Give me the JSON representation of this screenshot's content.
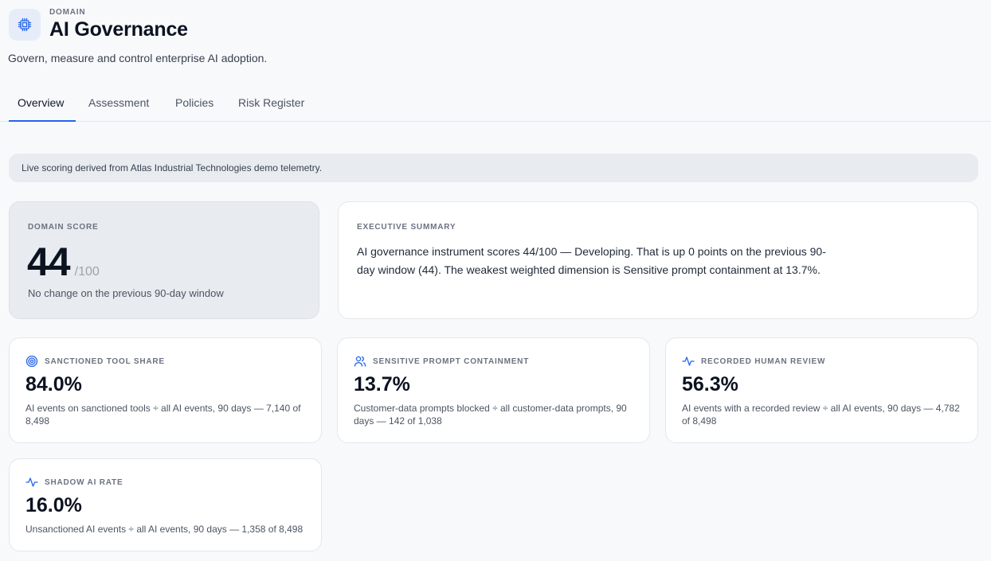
{
  "header": {
    "eyebrow": "DOMAIN",
    "title": "AI Governance",
    "subtitle": "Govern, measure and control enterprise AI adoption.",
    "icon": "cpu-chip-icon"
  },
  "tabs": [
    {
      "label": "Overview",
      "active": true
    },
    {
      "label": "Assessment",
      "active": false
    },
    {
      "label": "Policies",
      "active": false
    },
    {
      "label": "Risk Register",
      "active": false
    }
  ],
  "notice": "Live scoring derived from Atlas Industrial Technologies demo telemetry.",
  "score": {
    "eyebrow": "DOMAIN SCORE",
    "value": "44",
    "denominator": "/100",
    "note": "No change on the previous 90-day window"
  },
  "summary": {
    "eyebrow": "EXECUTIVE SUMMARY",
    "text": "AI governance instrument scores 44/100 — Developing. That is up 0 points on the previous 90-day window (44). The weakest weighted dimension is Sensitive prompt containment at 13.7%."
  },
  "metrics": [
    {
      "eyebrow": "SANCTIONED TOOL SHARE",
      "value": "84.0%",
      "desc": "AI events on sanctioned tools ÷ all AI events, 90 days — 7,140 of 8,498",
      "icon": "target-icon"
    },
    {
      "eyebrow": "SENSITIVE PROMPT CONTAINMENT",
      "value": "13.7%",
      "desc": "Customer-data prompts blocked ÷ all customer-data prompts, 90 days — 142 of 1,038",
      "icon": "users-icon"
    },
    {
      "eyebrow": "RECORDED HUMAN REVIEW",
      "value": "56.3%",
      "desc": "AI events with a recorded review ÷ all AI events, 90 days — 4,782 of 8,498",
      "icon": "activity-icon"
    },
    {
      "eyebrow": "SHADOW AI RATE",
      "value": "16.0%",
      "desc": "Unsanctioned AI events ÷ all AI events, 90 days — 1,358 of 8,498",
      "icon": "activity-icon"
    }
  ],
  "colors": {
    "accent": "#2563eb",
    "background": "#f8f9fb",
    "card": "#ffffff",
    "muted_card": "#e8ebef"
  }
}
